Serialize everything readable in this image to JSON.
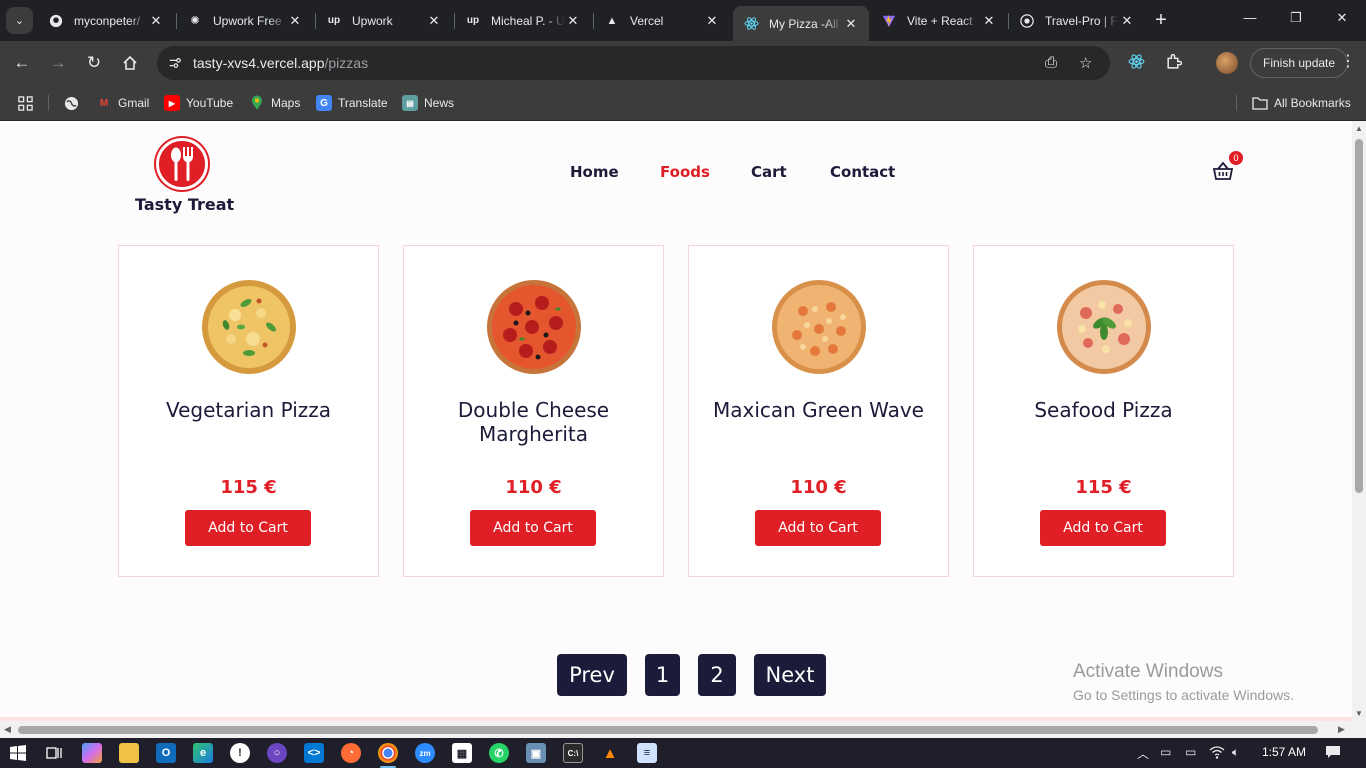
{
  "browser": {
    "tabs": [
      {
        "title": "myconpeter/",
        "icon": "github-icon"
      },
      {
        "title": "Upwork Free",
        "icon": "openai-icon"
      },
      {
        "title": "Upwork",
        "icon": "upwork-icon"
      },
      {
        "title": "Micheal P. - U",
        "icon": "upwork-icon"
      },
      {
        "title": "Vercel",
        "icon": "vercel-icon"
      },
      {
        "title": "My Pizza -All",
        "icon": "react-icon",
        "active": true
      },
      {
        "title": "Vite + React",
        "icon": "vite-icon"
      },
      {
        "title": "Travel-Pro | F",
        "icon": "globe-icon"
      }
    ],
    "url_host": "tasty-xvs4.vercel.app",
    "url_path": "/pizzas",
    "finish_update_label": "Finish update",
    "bookmarks": [
      {
        "label": "Gmail",
        "icon": "gmail-icon"
      },
      {
        "label": "YouTube",
        "icon": "youtube-icon"
      },
      {
        "label": "Maps",
        "icon": "maps-icon"
      },
      {
        "label": "Translate",
        "icon": "translate-icon"
      },
      {
        "label": "News",
        "icon": "news-icon"
      }
    ],
    "all_bookmarks_label": "All Bookmarks"
  },
  "site": {
    "logo_text": "Tasty Treat",
    "nav": [
      {
        "label": "Home",
        "active": false
      },
      {
        "label": "Foods",
        "active": true
      },
      {
        "label": "Cart",
        "active": false
      },
      {
        "label": "Contact",
        "active": false
      }
    ],
    "cart_count": "0",
    "add_to_cart_label": "Add to Cart",
    "products": [
      {
        "name": "Vegetarian Pizza",
        "price": "115 €",
        "image": "vegetarian-pizza"
      },
      {
        "name": "Double Cheese Margherita",
        "price": "110 €",
        "image": "pepperoni-pizza"
      },
      {
        "name": "Maxican Green Wave",
        "price": "110 €",
        "image": "mexican-pizza"
      },
      {
        "name": "Seafood Pizza",
        "price": "115 €",
        "image": "seafood-pizza"
      }
    ],
    "pagination": {
      "prev_label": "Prev",
      "pages": [
        "1",
        "2"
      ],
      "next_label": "Next"
    }
  },
  "os": {
    "watermark_title": "Activate Windows",
    "watermark_subtitle": "Go to Settings to activate Windows.",
    "clock": "1:57 AM"
  },
  "colors": {
    "accent": "#e01e25",
    "navy": "#1c1c3a",
    "card_border": "#f6d3d7",
    "page_bg": "#fdfbfc"
  }
}
